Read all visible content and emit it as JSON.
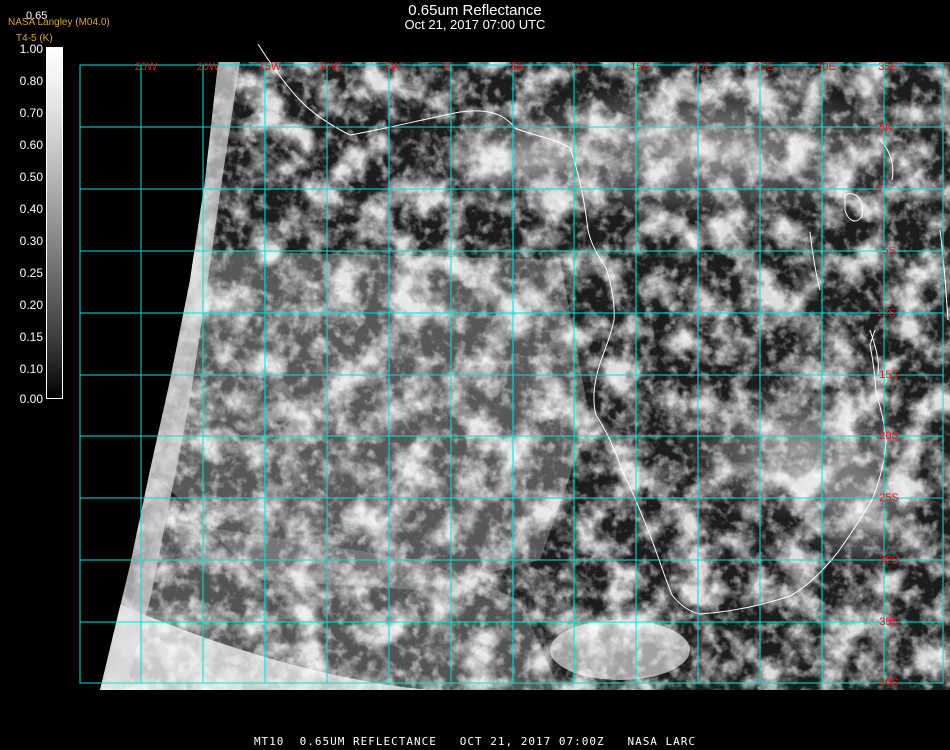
{
  "header": {
    "title": "0.65um Reflectance",
    "subtitle": "Oct 21, 2017 07:00 UTC",
    "org": "NASA Langley (M04.0)",
    "product": "T4-5 (K)",
    "scale_top": "0.65"
  },
  "colorbar": {
    "labels": [
      "1.00",
      "0.80",
      "0.70",
      "0.60",
      "0.50",
      "0.40",
      "0.30",
      "0.25",
      "0.20",
      "0.15",
      "0.10",
      "0.00"
    ]
  },
  "map": {
    "longitude_labels": [
      "25W",
      "20W",
      "15W",
      "10W",
      "5W",
      "0",
      "5E",
      "10E",
      "15E",
      "20E",
      "25E",
      "30E",
      "35E"
    ],
    "latitude_labels": [
      "5N",
      "0",
      "5S",
      "10S",
      "15S",
      "20S",
      "25S",
      "30S",
      "35S",
      "40S"
    ],
    "grid_color": "#00e0e0",
    "label_color": "#e01818",
    "coast_color": "#ffffff"
  },
  "footer": {
    "text": "MT10  0.65UM REFLECTANCE   OCT 21, 2017 07:00Z   NASA LARC"
  }
}
